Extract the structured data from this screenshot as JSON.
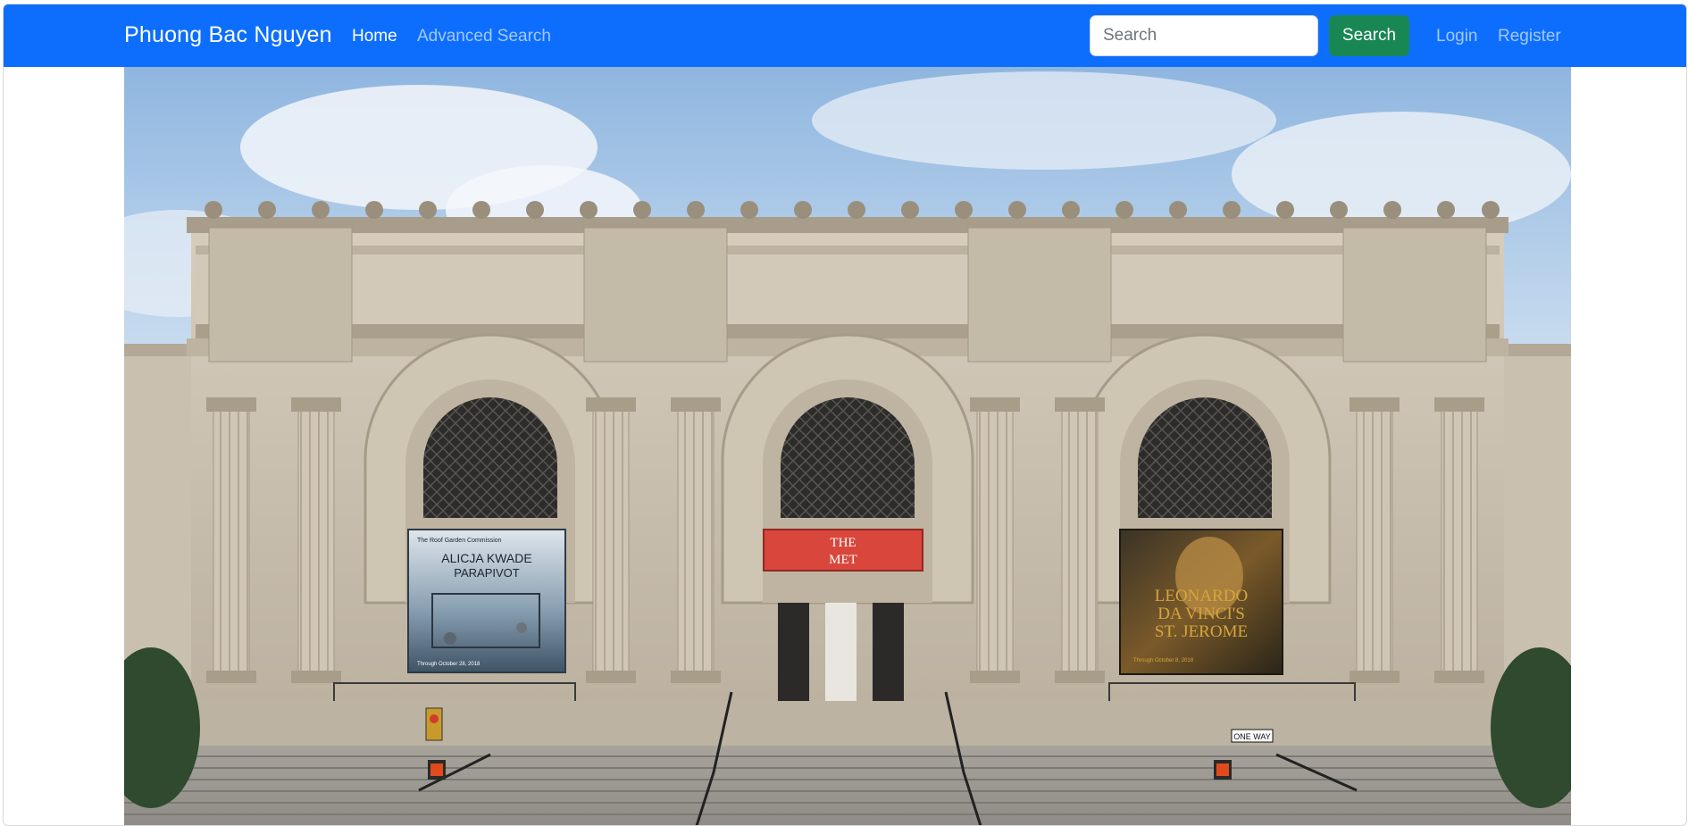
{
  "navbar": {
    "brand": "Phuong Bac Nguyen",
    "links": [
      {
        "label": "Home",
        "active": true
      },
      {
        "label": "Advanced Search",
        "active": false
      }
    ],
    "search": {
      "placeholder": "Search",
      "value": "",
      "button_label": "Search"
    },
    "auth": {
      "login_label": "Login",
      "register_label": "Register"
    }
  },
  "hero": {
    "image_icon": "museum-facade-image",
    "banners": {
      "left_small": "The Roof Garden Commission",
      "left_title_1": "ALICJA KWADE",
      "left_title_2": "PARAPIVOT",
      "left_date": "Through October 28, 2018",
      "center_1": "THE",
      "center_2": "MET",
      "right_1": "LEONARDO",
      "right_2": "DA VINCI'S",
      "right_3": "ST. JEROME",
      "right_date": "Through October 8, 2018"
    },
    "street_sign": "ONE WAY"
  },
  "colors": {
    "navbar": "#0d6efd",
    "search_button": "#198754",
    "banner_red": "#d9463c",
    "banner_gold": "#d5a63a"
  }
}
